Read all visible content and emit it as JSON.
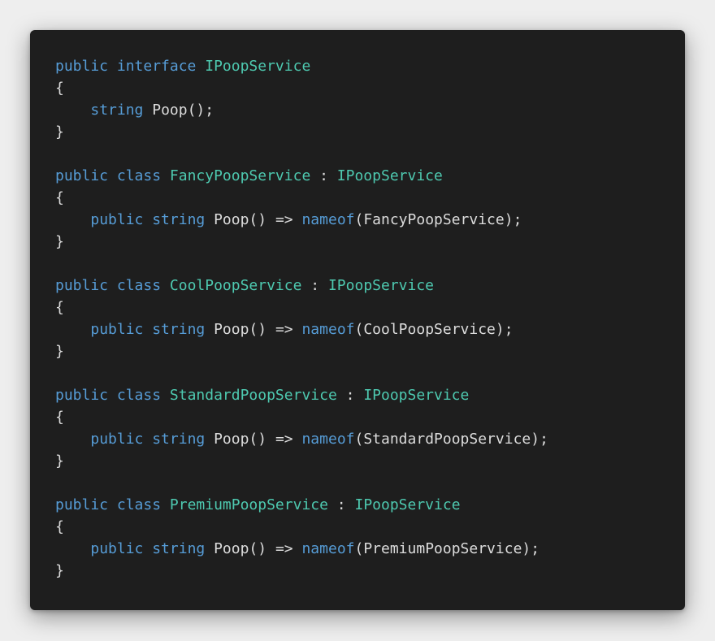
{
  "colors": {
    "keyword": "#569cd6",
    "type": "#4ec9b0",
    "method": "#dcdcaa",
    "plain": "#dcdcdc",
    "background": "#1e1e1e",
    "page_background": "#eeeeee"
  },
  "code": {
    "lines": [
      [
        {
          "text": "public interface ",
          "kind": "keyword"
        },
        {
          "text": "IPoopService",
          "kind": "type"
        }
      ],
      [
        {
          "text": "{",
          "kind": "plain"
        }
      ],
      [
        {
          "text": "    ",
          "kind": "plain"
        },
        {
          "text": "string",
          "kind": "keyword"
        },
        {
          "text": " Poop();",
          "kind": "plain"
        }
      ],
      [
        {
          "text": "}",
          "kind": "plain"
        }
      ],
      [],
      [
        {
          "text": "public class ",
          "kind": "keyword"
        },
        {
          "text": "FancyPoopService",
          "kind": "type"
        },
        {
          "text": " : ",
          "kind": "plain"
        },
        {
          "text": "IPoopService",
          "kind": "type"
        }
      ],
      [
        {
          "text": "{",
          "kind": "plain"
        }
      ],
      [
        {
          "text": "    ",
          "kind": "plain"
        },
        {
          "text": "public string",
          "kind": "keyword"
        },
        {
          "text": " Poop() => ",
          "kind": "plain"
        },
        {
          "text": "nameof",
          "kind": "keyword"
        },
        {
          "text": "(FancyPoopService);",
          "kind": "plain"
        }
      ],
      [
        {
          "text": "}",
          "kind": "plain"
        }
      ],
      [],
      [
        {
          "text": "public class ",
          "kind": "keyword"
        },
        {
          "text": "CoolPoopService",
          "kind": "type"
        },
        {
          "text": " : ",
          "kind": "plain"
        },
        {
          "text": "IPoopService",
          "kind": "type"
        }
      ],
      [
        {
          "text": "{",
          "kind": "plain"
        }
      ],
      [
        {
          "text": "    ",
          "kind": "plain"
        },
        {
          "text": "public string",
          "kind": "keyword"
        },
        {
          "text": " Poop() => ",
          "kind": "plain"
        },
        {
          "text": "nameof",
          "kind": "keyword"
        },
        {
          "text": "(CoolPoopService);",
          "kind": "plain"
        }
      ],
      [
        {
          "text": "}",
          "kind": "plain"
        }
      ],
      [],
      [
        {
          "text": "public class ",
          "kind": "keyword"
        },
        {
          "text": "StandardPoopService",
          "kind": "type"
        },
        {
          "text": " : ",
          "kind": "plain"
        },
        {
          "text": "IPoopService",
          "kind": "type"
        }
      ],
      [
        {
          "text": "{",
          "kind": "plain"
        }
      ],
      [
        {
          "text": "    ",
          "kind": "plain"
        },
        {
          "text": "public string",
          "kind": "keyword"
        },
        {
          "text": " Poop() => ",
          "kind": "plain"
        },
        {
          "text": "nameof",
          "kind": "keyword"
        },
        {
          "text": "(StandardPoopService);",
          "kind": "plain"
        }
      ],
      [
        {
          "text": "}",
          "kind": "plain"
        }
      ],
      [],
      [
        {
          "text": "public class ",
          "kind": "keyword"
        },
        {
          "text": "PremiumPoopService",
          "kind": "type"
        },
        {
          "text": " : ",
          "kind": "plain"
        },
        {
          "text": "IPoopService",
          "kind": "type"
        }
      ],
      [
        {
          "text": "{",
          "kind": "plain"
        }
      ],
      [
        {
          "text": "    ",
          "kind": "plain"
        },
        {
          "text": "public string",
          "kind": "keyword"
        },
        {
          "text": " Poop() => ",
          "kind": "plain"
        },
        {
          "text": "nameof",
          "kind": "keyword"
        },
        {
          "text": "(PremiumPoopService);",
          "kind": "plain"
        }
      ],
      [
        {
          "text": "}",
          "kind": "plain"
        }
      ]
    ]
  }
}
